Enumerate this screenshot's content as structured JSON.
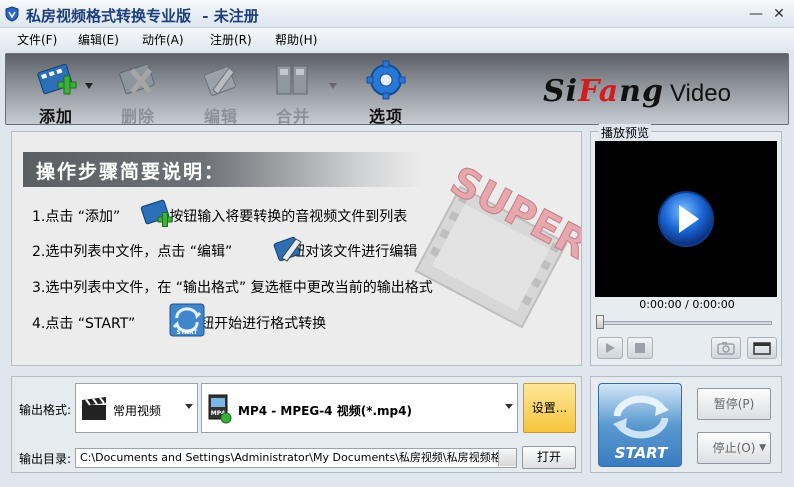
{
  "window": {
    "title": "私房视频格式转换专业版",
    "title_suffix": "- 未注册",
    "minimize_glyph": "—",
    "close_glyph": "✕"
  },
  "menu": [
    {
      "label": "文件(F)"
    },
    {
      "label": "编辑(E)"
    },
    {
      "label": "动作(A)"
    },
    {
      "label": "注册(R)"
    },
    {
      "label": "帮助(H)"
    }
  ],
  "toolbar": {
    "add": "添加",
    "delete": "删除",
    "edit": "编辑",
    "merge": "合并",
    "options": "选项",
    "brand_si": "Si",
    "brand_fa": "Fa",
    "brand_ng": "ng",
    "brand_video": "Video"
  },
  "instructions": {
    "heading": "操作步骤简要说明：",
    "watermark": "SUPER",
    "step1_a": "1.点击 “添加”",
    "step1_b": "按钮输入将要转换的音视频文件到列表",
    "step2_a": "2.选中列表中文件，点击 “编辑”",
    "step2_b": "按钮对该文件进行编辑",
    "step3": "3.选中列表中文件，在 “输出格式” 复选框中更改当前的输出格式",
    "step4_a": "4.点击 “START”",
    "step4_b": "按钮开始进行格式转换",
    "start_icon_text": "START"
  },
  "preview": {
    "title": "播放预览",
    "time": "0:00:00 / 0:00:00",
    "seek_fraction": 0
  },
  "output": {
    "format_label": "输出格式:",
    "category": "常用视频",
    "format": "MP4 - MPEG-4 视频(*.mp4)",
    "settings_button": "设置...",
    "dir_label": "输出目录:",
    "dir_path": "C:\\Documents and Settings\\Administrator\\My Documents\\私房视频\\私房视频格式转换",
    "open_button": "打开"
  },
  "controls": {
    "start": "START",
    "pause": "暂停(P)",
    "stop": "停止(O)"
  },
  "colors": {
    "title_text": "#1c3f7a",
    "brand_red": "#d21d20",
    "settings_button": "#f7c43b",
    "start_button": "#3a7cc1"
  }
}
